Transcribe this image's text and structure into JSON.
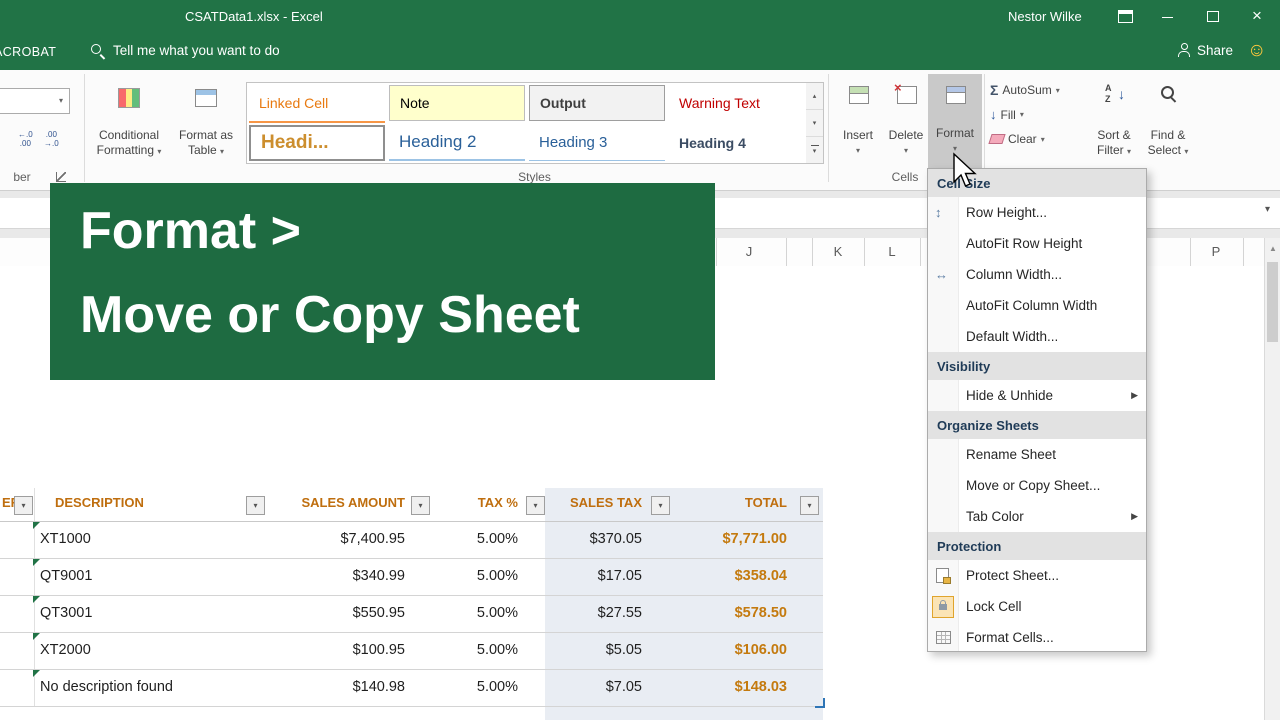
{
  "colors": {
    "excel_green": "#217346",
    "banner_green": "#1E6B41",
    "table_header_orange": "#BF6E0E",
    "total_orange": "#C47A0E",
    "tinted_column_bg": "#E9EDF3"
  },
  "title_bar": {
    "title": "CSATData1.xlsx - Excel",
    "user": "Nestor Wilke"
  },
  "tab_row": {
    "acrobat_tab": "ACROBAT",
    "tell_me": "Tell me what you want to do",
    "share": "Share"
  },
  "ribbon": {
    "conditional_formatting": "Conditional Formatting",
    "format_as_table": "Format as Table",
    "styles_label": "Styles",
    "cells_label": "Cells",
    "number_label_partial": "ber",
    "styles": [
      {
        "label": "Linked Cell"
      },
      {
        "label": "Note"
      },
      {
        "label": "Output"
      },
      {
        "label": "Warning Text"
      },
      {
        "label": "Headi..."
      },
      {
        "label": "Heading 2"
      },
      {
        "label": "Heading 3"
      },
      {
        "label": "Heading 4"
      }
    ],
    "buttons": {
      "insert": "Insert",
      "delete": "Delete",
      "format": "Format",
      "autosum": "AutoSum",
      "fill": "Fill",
      "clear": "Clear",
      "sort_filter": "Sort & Filter",
      "find_select": "Find & Select"
    },
    "decimal_icons": {
      "increase": "←.0\n.00",
      "decrease": ".00\n→.0"
    }
  },
  "overlay_banner": {
    "line1": "Format >",
    "line2": "Move or Copy Sheet"
  },
  "format_menu": {
    "items": [
      {
        "type": "header",
        "label": "Cell Size"
      },
      {
        "type": "item",
        "label": "Row Height..."
      },
      {
        "type": "item",
        "label": "AutoFit Row Height"
      },
      {
        "type": "item",
        "label": "Column Width..."
      },
      {
        "type": "item",
        "label": "AutoFit Column Width"
      },
      {
        "type": "item",
        "label": "Default Width..."
      },
      {
        "type": "header",
        "label": "Visibility"
      },
      {
        "type": "item",
        "label": "Hide & Unhide",
        "submenu": true
      },
      {
        "type": "header",
        "label": "Organize Sheets"
      },
      {
        "type": "item",
        "label": "Rename Sheet"
      },
      {
        "type": "item",
        "label": "Move or Copy Sheet..."
      },
      {
        "type": "item",
        "label": "Tab Color",
        "submenu": true
      },
      {
        "type": "header",
        "label": "Protection"
      },
      {
        "type": "item",
        "label": "Protect Sheet..."
      },
      {
        "type": "item",
        "label": "Lock Cell"
      },
      {
        "type": "item",
        "label": "Format Cells..."
      }
    ]
  },
  "column_headers": [
    "J",
    "K",
    "L",
    "P"
  ],
  "sheet_table": {
    "headers": [
      "ER",
      "DESCRIPTION",
      "SALES AMOUNT",
      "TAX %",
      "SALES TAX",
      "TOTAL"
    ],
    "rows": [
      [
        "XT1000",
        "$7,400.95",
        "5.00%",
        "$370.05",
        "$7,771.00"
      ],
      [
        "QT9001",
        "$340.99",
        "5.00%",
        "$17.05",
        "$358.04"
      ],
      [
        "QT3001",
        "$550.95",
        "5.00%",
        "$27.55",
        "$578.50"
      ],
      [
        "XT2000",
        "$100.95",
        "5.00%",
        "$5.05",
        "$106.00"
      ],
      [
        "No description found",
        "$140.98",
        "5.00%",
        "$7.05",
        "$148.03"
      ]
    ]
  }
}
